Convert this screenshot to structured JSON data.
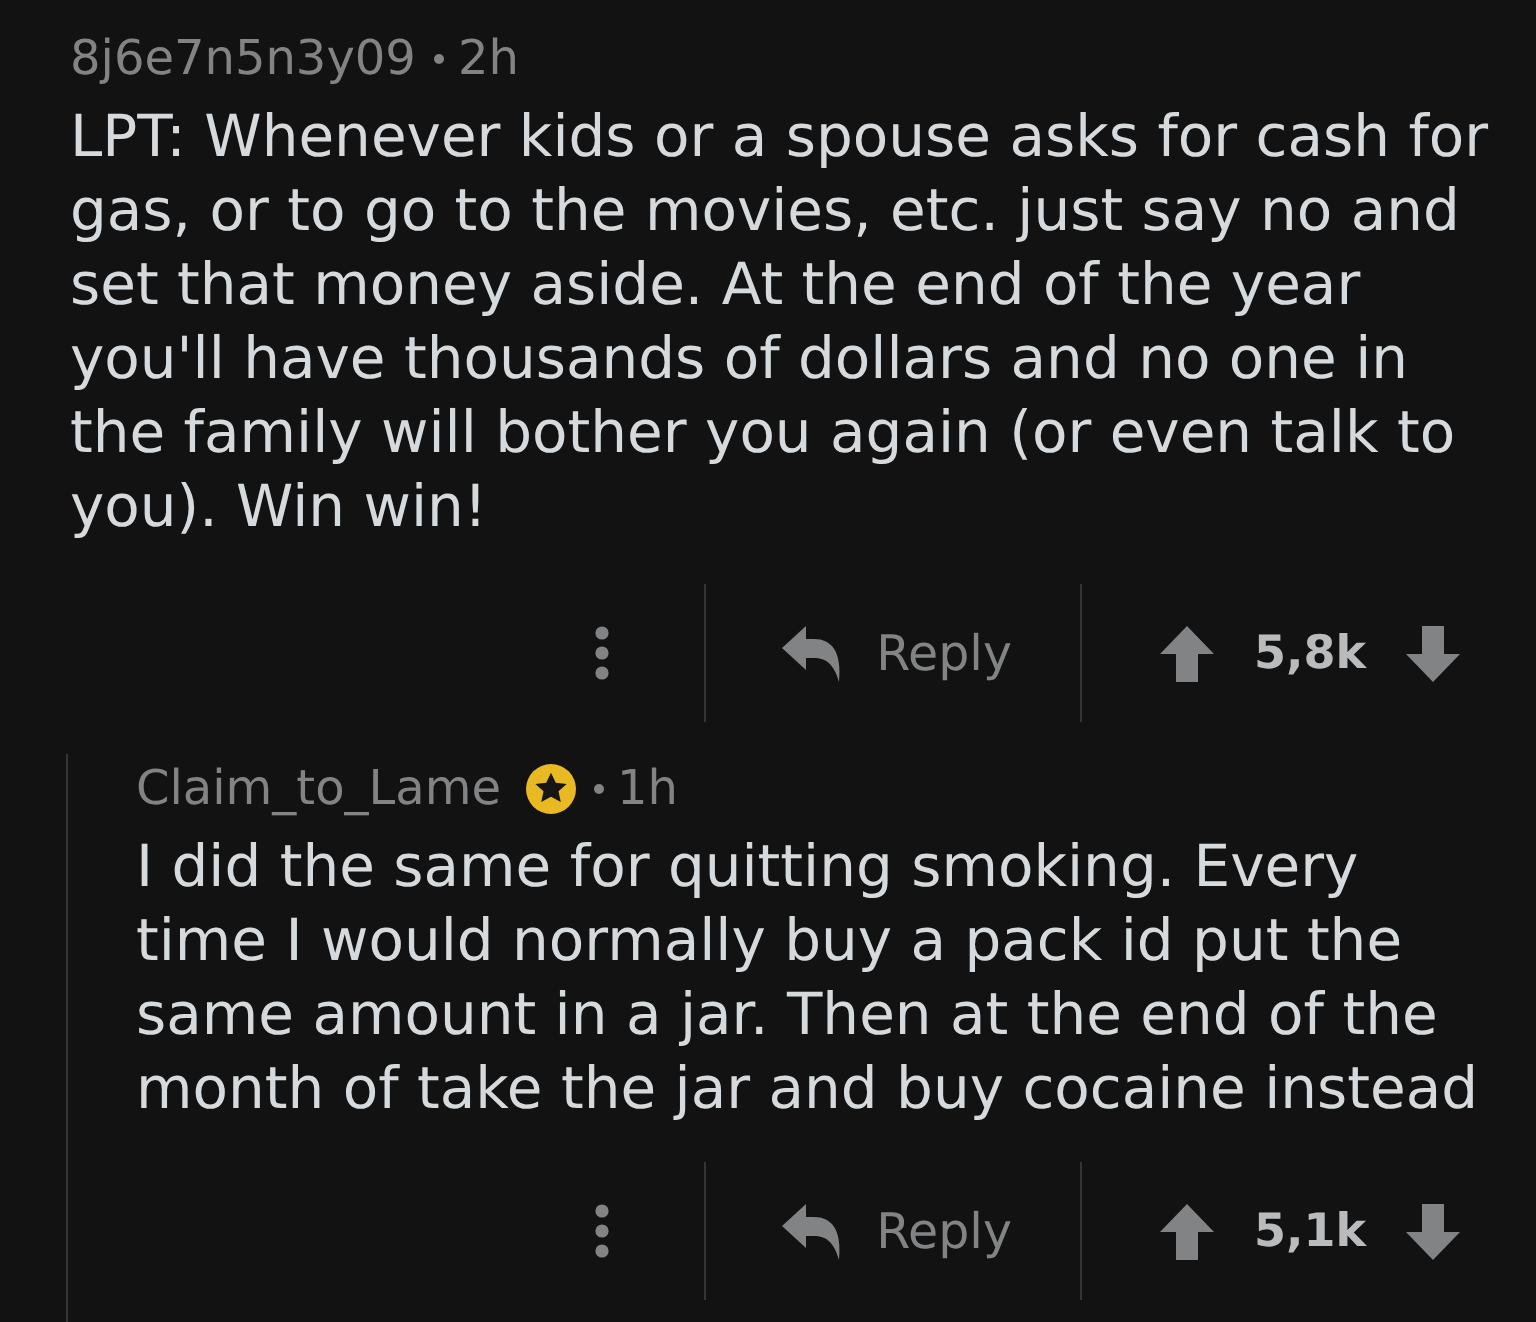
{
  "comments": [
    {
      "author": "8j6e7n5n3y09",
      "award": false,
      "age": "2h",
      "body": "LPT: Whenever kids or a spouse asks for cash for gas, or to go to the movies, etc. just say no and set that money aside. At the end of the year you'll have thousands of dollars and no one in the family will bother you again (or even talk to you). Win win!",
      "actions": {
        "reply": "Reply",
        "score": "5,8k"
      },
      "children": [
        {
          "author": "Claim_to_Lame",
          "award": true,
          "age": "1h",
          "body": "I did the same for quitting smoking. Every time I would normally buy a pack id put the same amount in a jar. Then at the end of the month of take the jar and buy cocaine instead",
          "actions": {
            "reply": "Reply",
            "score": "5,1k"
          }
        }
      ]
    }
  ]
}
